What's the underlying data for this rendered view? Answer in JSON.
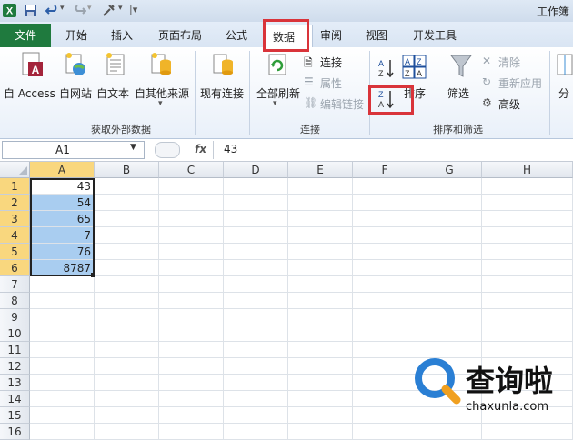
{
  "window": {
    "title": "工作簿"
  },
  "tabs": {
    "file": "文件",
    "home": "开始",
    "insert": "插入",
    "layout": "页面布局",
    "formula": "公式",
    "data": "数据",
    "review": "审阅",
    "view": "视图",
    "developer": "开发工具"
  },
  "ribbon": {
    "external": {
      "access": "自 Access",
      "web": "自网站",
      "text": "自文本",
      "other": "自其他来源",
      "existing": "现有连接",
      "group_label": "获取外部数据"
    },
    "connections": {
      "refresh_all": "全部刷新",
      "connections": "连接",
      "properties": "属性",
      "edit_links": "编辑链接",
      "group_label": "连接"
    },
    "sort_filter": {
      "sort": "排序",
      "filter": "筛选",
      "clear": "清除",
      "reapply": "重新应用",
      "advanced": "高级",
      "group_label": "排序和筛选",
      "split": "分"
    }
  },
  "formula_bar": {
    "name_box": "A1",
    "fx": "fx",
    "value": "43"
  },
  "columns": [
    "A",
    "B",
    "C",
    "D",
    "E",
    "F",
    "G",
    "H"
  ],
  "rows": [
    "1",
    "2",
    "3",
    "4",
    "5",
    "6",
    "7",
    "8",
    "9",
    "10",
    "11",
    "12",
    "13",
    "14",
    "15",
    "16"
  ],
  "column_a_values": [
    "43",
    "54",
    "65",
    "7",
    "76",
    "8787"
  ],
  "watermark": {
    "name": "查询啦",
    "url": "chaxunla.com"
  },
  "colors": {
    "file_tab": "#1f7a3e",
    "highlight": "#d9343a",
    "selection": "#a9cdf0",
    "active_header": "#f9d77e"
  }
}
